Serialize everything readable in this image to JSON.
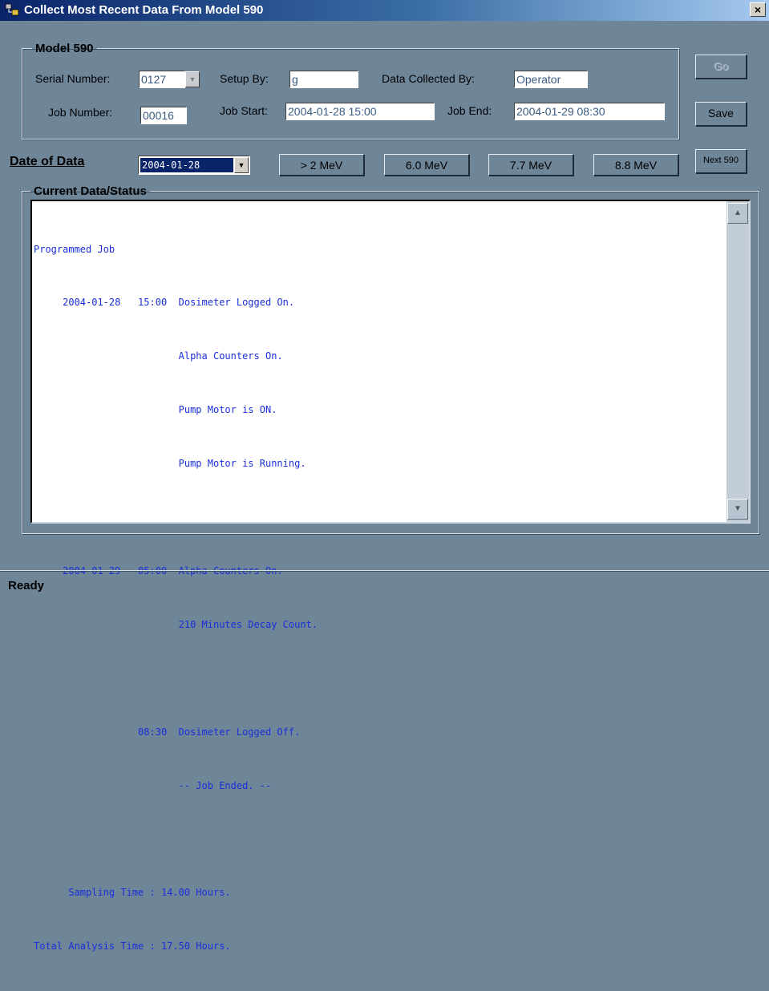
{
  "window": {
    "title": "Collect Most Recent Data From Model 590",
    "close_glyph": "×"
  },
  "model_group": {
    "legend": "Model 590",
    "serial_label": "Serial Number:",
    "serial_value": "0127",
    "setup_by_label": "Setup By:",
    "setup_by_value": "g",
    "collected_by_label": "Data Collected By:",
    "collected_by_value": "Operator",
    "job_number_label": "Job Number:",
    "job_number_value": "00016",
    "job_start_label": "Job Start:",
    "job_start_value": "2004-01-28   15:00",
    "job_end_label": "Job End:",
    "job_end_value": "2004-01-29   08:30"
  },
  "buttons": {
    "go": "Go",
    "save": "Save",
    "next": "Next 590",
    "mev_gt2": "> 2 MeV",
    "mev_6": "6.0 MeV",
    "mev_7": "7.7 MeV",
    "mev_8": "8.8 MeV"
  },
  "date_of_data": {
    "label": "Date of Data",
    "value": "2004-01-28"
  },
  "status_group": {
    "legend": "Current Data/Status",
    "lines": [
      "Programmed Job",
      "     2004-01-28   15:00  Dosimeter Logged On.",
      "                         Alpha Counters On.",
      "                         Pump Motor is ON.",
      "                         Pump Motor is Running.",
      "",
      "     2004-01-29   05:00  Alpha Counters On.",
      "                         210 Minutes Decay Count.",
      "",
      "                  08:30  Dosimeter Logged Off.",
      "                         -- Job Ended. --",
      "",
      "      Sampling Time : 14.00 Hours.",
      "Total Analysis Time : 17.50 Hours."
    ]
  },
  "statusbar": {
    "text": "Ready"
  },
  "colors": {
    "window_bg": "#6f8598",
    "title_start": "#0a246a",
    "title_end": "#a6caf0",
    "console_text": "#1a2fd8"
  }
}
